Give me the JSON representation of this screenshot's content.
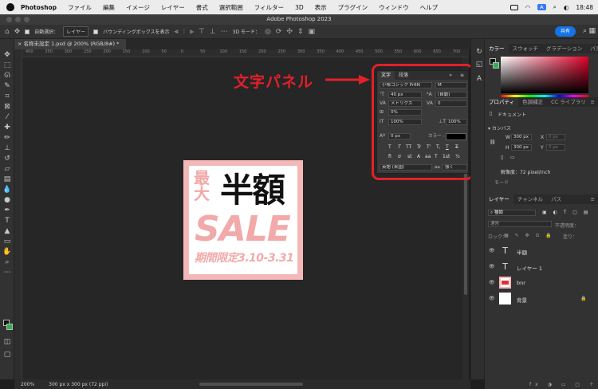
{
  "menubar": {
    "app": "Photoshop",
    "items": [
      "ファイル",
      "編集",
      "イメージ",
      "レイヤー",
      "書式",
      "選択範囲",
      "フィルター",
      "3D"
    ],
    "right_items": [
      "表示",
      "プラグイン",
      "ウィンドウ",
      "ヘルプ"
    ],
    "input_badge": "A",
    "clock": "18:48"
  },
  "window": {
    "title": "Adobe Photoshop 2023"
  },
  "optionsbar": {
    "auto_select_label": "自動選択：",
    "auto_select_value": "レイヤー",
    "bounding_box_label": "バウンディングボックスを表示",
    "mode_3d": "3D モード：",
    "share_label": "共有"
  },
  "document": {
    "tab_title": "名称未設定 1.psd @ 200% (RGB/8#) *",
    "zoom": "200%",
    "size_info": "300 px x 300 px (72 ppi)"
  },
  "ruler": {
    "ticks": [
      "400",
      "350",
      "300",
      "250",
      "200",
      "150",
      "100",
      "50",
      "0",
      "50",
      "100",
      "150",
      "200",
      "250",
      "300",
      "350",
      "400",
      "450",
      "500",
      "550",
      "600",
      "650",
      "700"
    ]
  },
  "artwork": {
    "max_text": "最大",
    "half_text": "半額",
    "sale_text": "SALE",
    "period_text": "期間限定3.10-3.31",
    "border_color": "#f4b8b8",
    "text_color": "#f2a9a9"
  },
  "annotation": {
    "label": "文字パネル",
    "color": "#e2202a"
  },
  "character_panel": {
    "tabs": [
      "文字",
      "段落"
    ],
    "font_family": "小塚ゴシック Pr6N",
    "font_style": "M",
    "font_size": "40 px",
    "leading": "(自動)",
    "kerning": "メトリクス",
    "tracking": "0",
    "tsume": "0%",
    "vertical_scale": "100%",
    "horizontal_scale": "100%",
    "baseline_shift": "0 px",
    "color_label": "カラー :",
    "type_styles": [
      "T",
      "T",
      "TT",
      "Tr",
      "T'",
      "T,",
      "T",
      "T"
    ],
    "opentype": [
      "fi",
      "ơ",
      "st",
      "A",
      "aa",
      "T",
      "1st",
      "½"
    ],
    "language": "英語 (米国)",
    "anti_alias": "強く",
    "aa_label": "aa"
  },
  "color_panel": {
    "tabs": [
      "カラー",
      "スウォッチ",
      "グラデーション",
      "パターン"
    ],
    "foreground": "#111111",
    "background": "#2db34a"
  },
  "properties_panel": {
    "tabs": [
      "プロパティ",
      "色調補正",
      "CC ライブラリ"
    ],
    "doc_label": "ドキュメント",
    "canvas_label": "カンバス",
    "w_label": "W",
    "w_value": "300 px",
    "h_label": "H",
    "h_value": "300 px",
    "x_label": "X",
    "x_value": "0 px",
    "y_label": "Y",
    "y_value": "0 px",
    "resolution": "解像度：72 pixel/inch",
    "mode_label": "モード"
  },
  "layers_panel": {
    "tabs": [
      "レイヤー",
      "チャンネル",
      "パス"
    ],
    "filter": "種類",
    "blend_mode": "通常",
    "opacity_label": "不透明度：",
    "lock_label": "ロック：",
    "fill_label": "塗り：",
    "layers": [
      {
        "name": "半額",
        "kind": "text"
      },
      {
        "name": "レイヤー 1",
        "kind": "text"
      },
      {
        "name": "bnr",
        "kind": "image"
      },
      {
        "name": "背景",
        "kind": "background"
      }
    ]
  }
}
